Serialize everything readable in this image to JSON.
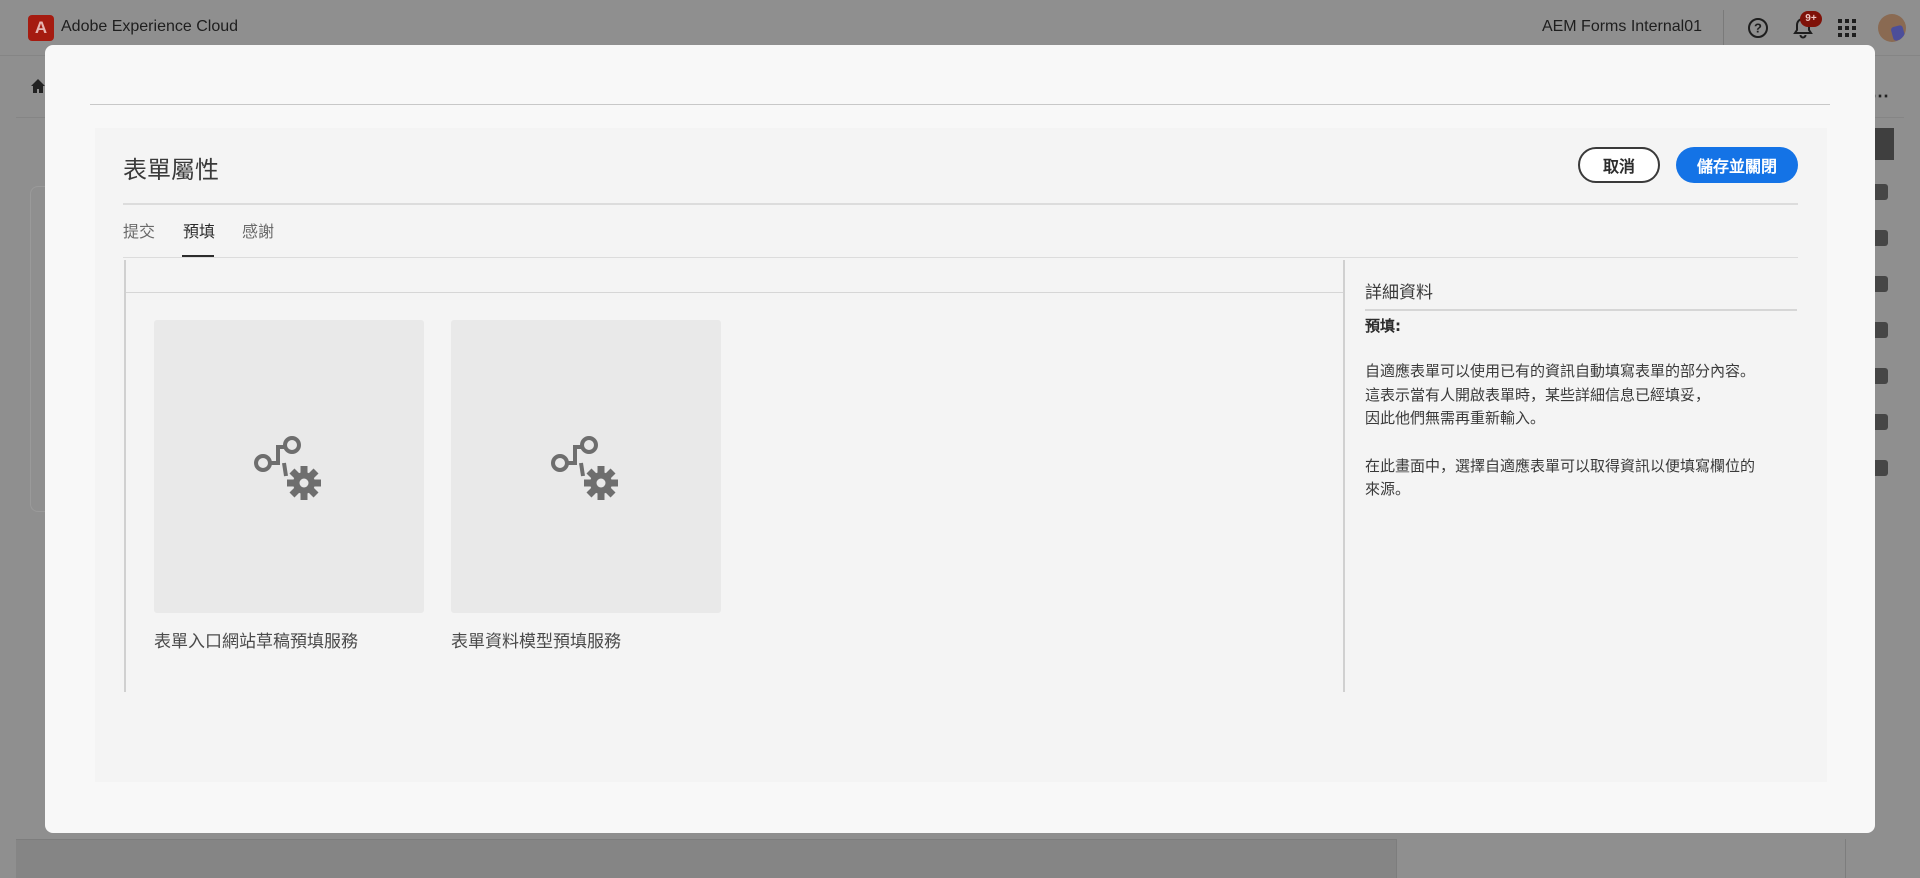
{
  "shell": {
    "app_title": "Adobe Experience Cloud",
    "org_name": "AEM Forms Internal01",
    "notification_badge": "9+",
    "icons": [
      "adobe-logo-icon",
      "help-icon",
      "bell-icon",
      "apps-grid-icon",
      "avatar"
    ]
  },
  "dialog": {
    "title": "表單屬性",
    "cancel_label": "取消",
    "save_label": "儲存並關閉",
    "tabs": [
      {
        "label": "提交",
        "active": false
      },
      {
        "label": "預填",
        "active": true
      },
      {
        "label": "感謝",
        "active": false
      }
    ],
    "cards": [
      {
        "label": "表單入口網站草稿預填服務",
        "icon": "workflow-gear-icon"
      },
      {
        "label": "表單資料模型預填服務",
        "icon": "workflow-gear-icon"
      }
    ],
    "details": {
      "title": "詳細資料",
      "subtitle": "預填:",
      "paragraph1": [
        "自適應表單可以使用已有的資訊自動填寫表單的部分內容。",
        "這表示當有人開啟表單時，某些詳細信息已經填妥，",
        "因此他們無需再重新輸入。"
      ],
      "paragraph2": [
        "在此畫面中，選擇自適應表單可以取得資訊以便填寫欄位的",
        "來源。"
      ]
    }
  },
  "colors": {
    "accent": "#1473e6",
    "overlay": "#8f8f8f",
    "modal_bg": "#f8f8f8",
    "card_bg": "#e9e9e9"
  }
}
